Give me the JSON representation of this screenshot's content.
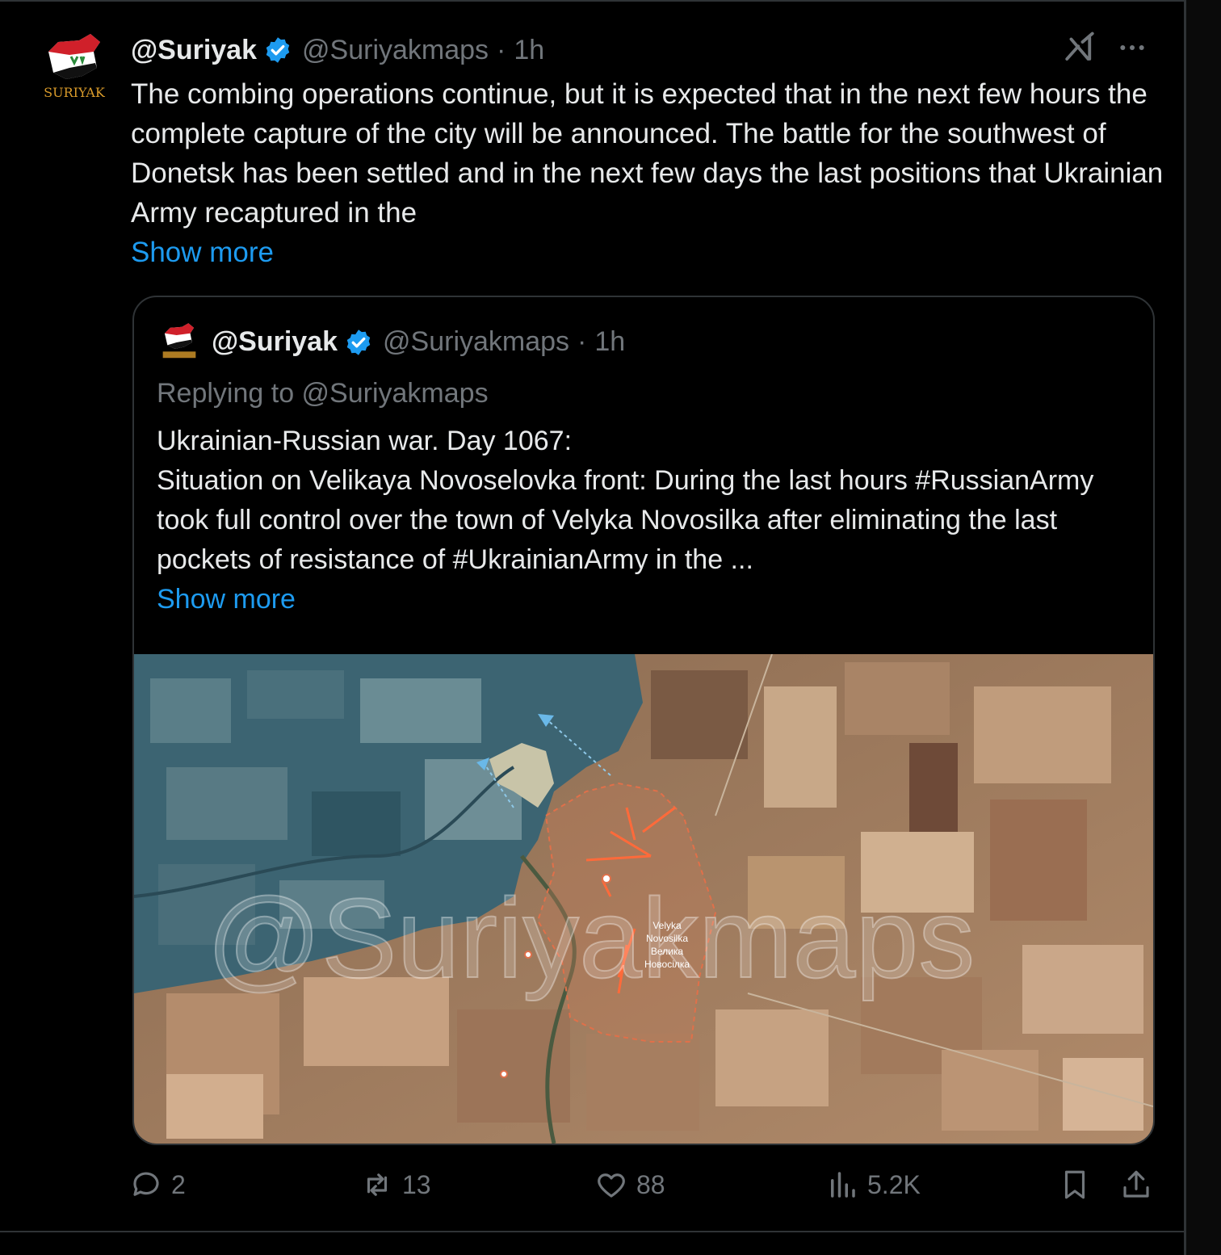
{
  "post": {
    "display_name": "@Suriyak",
    "handle": "@Suriyakmaps",
    "separator": "·",
    "time": "1h",
    "avatar_text": "SURIYAK",
    "text": "The combing operations continue, but it is expected that in the next few hours the complete capture of the city will be announced. The battle for the southwest of Donetsk has been settled and in the next few days the last positions that Ukrainian Army recaptured in the",
    "show_more": "Show more"
  },
  "quote": {
    "display_name": "@Suriyak",
    "handle": "@Suriyakmaps",
    "separator": "·",
    "time": "1h",
    "replying_to": "Replying to @Suriyakmaps",
    "line1": "Ukrainian-Russian war. Day 1067:",
    "line2": "Situation on Velikaya Novoselovka front: During the last hours #RussianArmy took full control over the town of Velyka Novosilka after eliminating the last pockets of resistance of #UkrainianArmy in the ...",
    "show_more": "Show more",
    "map": {
      "watermark": "@Suriyakmaps",
      "town_label_1": "Velyka",
      "town_label_2": "Novosilka",
      "town_label_3": "Велика",
      "town_label_4": "Новосілка"
    }
  },
  "actions": {
    "replies": "2",
    "reposts": "13",
    "likes": "88",
    "views": "5.2K"
  },
  "colors": {
    "background": "#000000",
    "text": "#e7e9ea",
    "muted": "#71767b",
    "link": "#1d9bf0",
    "border": "#2f3336",
    "verified": "#1d9bf0"
  },
  "icons": [
    "verified-badge-icon",
    "grok-icon",
    "more-icon",
    "reply-icon",
    "repost-icon",
    "like-icon",
    "views-icon",
    "bookmark-icon",
    "share-icon"
  ]
}
